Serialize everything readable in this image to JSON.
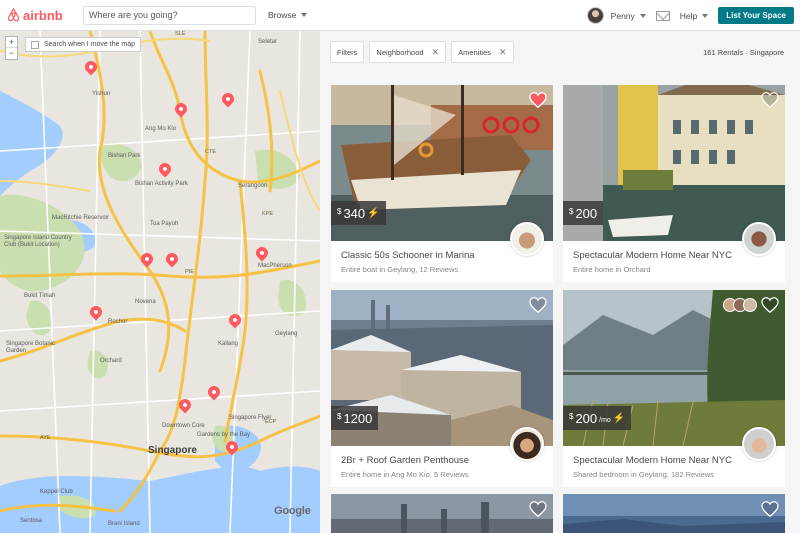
{
  "header": {
    "brand": "airbnb",
    "search_placeholder": "Where are you going?",
    "browse_label": "Browse",
    "user_name": "Penny",
    "help_label": "Help",
    "list_space_label": "List Your Space"
  },
  "map": {
    "zoom_in": "+",
    "zoom_out": "−",
    "move_checkbox_label": "Search when I move the map",
    "attribution": "Google",
    "labels": {
      "yishun": "Yishun",
      "seletar": "Seletar",
      "ang_mo_kio": "Ang Mo Kio",
      "bishan_park": "Bishan Park",
      "bishan_activity_park": "Bishan Activity Park",
      "serangoon": "Serangoon",
      "macritchie": "MacRitchie Reservoir",
      "golf_club": "Singapore Island Country Club (Bukit Location)",
      "toa_payoh": "Toa Payoh",
      "macpherson": "MacPherson",
      "bukit_timah": "Bukit Timah",
      "novena": "Novena",
      "kallang": "Kallang",
      "botanic": "Singapore Botanic Garden",
      "orchard": "Orchard",
      "downtown": "Downtown Core",
      "gardens_bay": "Gardens by the Bay",
      "singapore": "Singapore",
      "flyer": "Singapore Flyer",
      "keppel": "Keppel Club",
      "brani": "Brani Island",
      "sentosa": "Sentosa",
      "rochor": "Rochor",
      "geylang": "Geylang"
    },
    "roads": [
      "SLE",
      "CTE",
      "PIE",
      "AYE",
      "ECP",
      "KPE"
    ]
  },
  "filters": {
    "filters_label": "Filters",
    "neighborhood_label": "Neighborhood",
    "amenities_label": "Amenities",
    "results_count": "161 Rentals · Singapore"
  },
  "listings": [
    {
      "price_currency": "$",
      "price": "340",
      "instant": true,
      "per_month": "",
      "title": "Classic 50s Schooner in Marina",
      "subtitle": "Entire boat in Geylang, 12 Reviews",
      "favorited": true
    },
    {
      "price_currency": "$",
      "price": "200",
      "instant": false,
      "per_month": "",
      "title": "Spectacular Modern Home Near NYC",
      "subtitle": "Entire home in Orchard",
      "favorited": false
    },
    {
      "price_currency": "$",
      "price": "1200",
      "instant": false,
      "per_month": "",
      "title": "2Br + Roof Garden Penthouse",
      "subtitle": "Entire home in Ang Mo Kio, 5 Reviews",
      "favorited": false
    },
    {
      "price_currency": "$",
      "price": "200",
      "instant": true,
      "per_month": "/mo",
      "title": "Spectacular Modern Home Near NYC",
      "subtitle": "Shared bedroom in Geylang, 182 Reviews",
      "favorited": false
    }
  ],
  "colors": {
    "brand": "#ff5a5f",
    "accent": "#007a87",
    "instant": "#ffb400"
  }
}
